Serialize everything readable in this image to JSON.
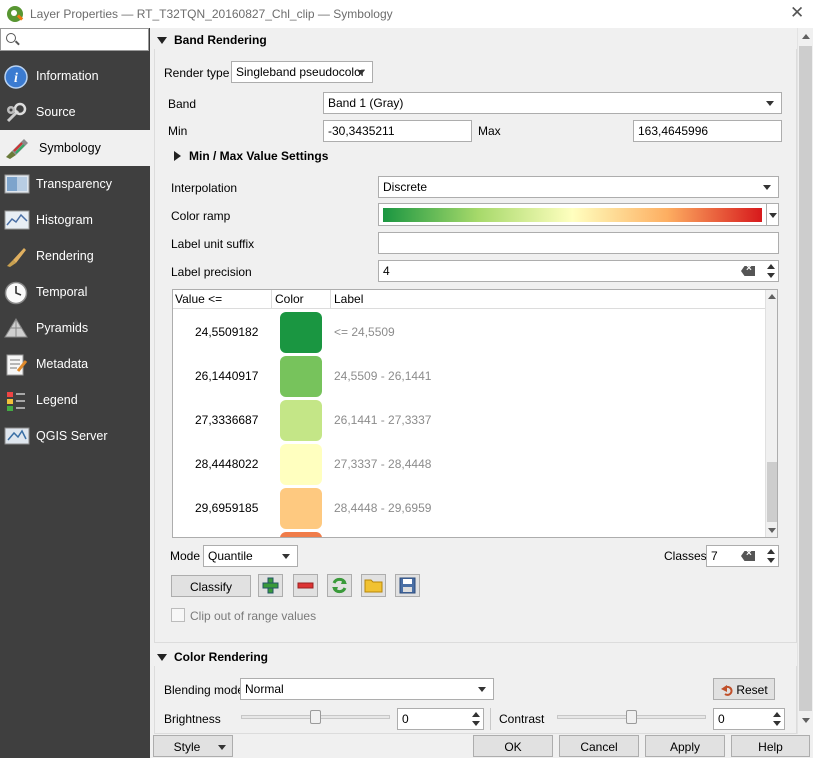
{
  "window": {
    "title": "Layer Properties — RT_T32TQN_20160827_Chl_clip — Symbology"
  },
  "search": {
    "placeholder": ""
  },
  "sidebar": {
    "items": [
      {
        "label": "Information",
        "icon": "info-icon"
      },
      {
        "label": "Source",
        "icon": "wrench-icon"
      },
      {
        "label": "Symbology",
        "icon": "brush-icon",
        "selected": true
      },
      {
        "label": "Transparency",
        "icon": "transparency-icon"
      },
      {
        "label": "Histogram",
        "icon": "histogram-icon"
      },
      {
        "label": "Rendering",
        "icon": "paintbrush-icon"
      },
      {
        "label": "Temporal",
        "icon": "clock-icon"
      },
      {
        "label": "Pyramids",
        "icon": "pyramid-icon"
      },
      {
        "label": "Metadata",
        "icon": "metadata-icon"
      },
      {
        "label": "Legend",
        "icon": "legend-icon"
      },
      {
        "label": "QGIS Server",
        "icon": "server-icon"
      }
    ]
  },
  "band_rendering": {
    "header": "Band Rendering",
    "render_type_label": "Render type",
    "render_type": "Singleband pseudocolor",
    "band_label": "Band",
    "band": "Band 1 (Gray)",
    "min_label": "Min",
    "min": "-30,3435211",
    "max_label": "Max",
    "max": "163,4645996",
    "minmax_header": "Min / Max Value Settings",
    "interpolation_label": "Interpolation",
    "interpolation": "Discrete",
    "color_ramp_label": "Color ramp",
    "color_ramp_colors": [
      "#1a9641",
      "#a6d96a",
      "#ffffbf",
      "#fdae61",
      "#d7191c"
    ],
    "label_unit_suffix_label": "Label unit suffix",
    "label_unit_suffix": "",
    "label_precision_label": "Label precision",
    "label_precision": "4",
    "table": {
      "columns": [
        "Value <=",
        "Color",
        "Label"
      ],
      "rows": [
        {
          "value": "24,5509182",
          "color": "#1a9641",
          "label": "<= 24,5509"
        },
        {
          "value": "26,1440917",
          "color": "#77c35c",
          "label": "24,5509 - 26,1441"
        },
        {
          "value": "27,3336687",
          "color": "#c4e687",
          "label": "26,1441 - 27,3337"
        },
        {
          "value": "28,4448022",
          "color": "#ffffbf",
          "label": "27,3337 - 28,4448"
        },
        {
          "value": "29,6959185",
          "color": "#fec980",
          "label": "28,4448 - 29,6959"
        },
        {
          "value": "",
          "color": "#f07c4a",
          "label": ""
        }
      ]
    },
    "mode_label": "Mode",
    "mode": "Quantile",
    "classes_label": "Classes",
    "classes": "7",
    "classify_label": "Classify",
    "clip_label": "Clip out of range values"
  },
  "color_rendering": {
    "header": "Color Rendering",
    "blending_mode_label": "Blending mode",
    "blending_mode": "Normal",
    "reset_label": "Reset",
    "brightness_label": "Brightness",
    "brightness": "0",
    "contrast_label": "Contrast",
    "contrast": "0"
  },
  "footer": {
    "style_label": "Style",
    "ok_label": "OK",
    "cancel_label": "Cancel",
    "apply_label": "Apply",
    "help_label": "Help"
  }
}
